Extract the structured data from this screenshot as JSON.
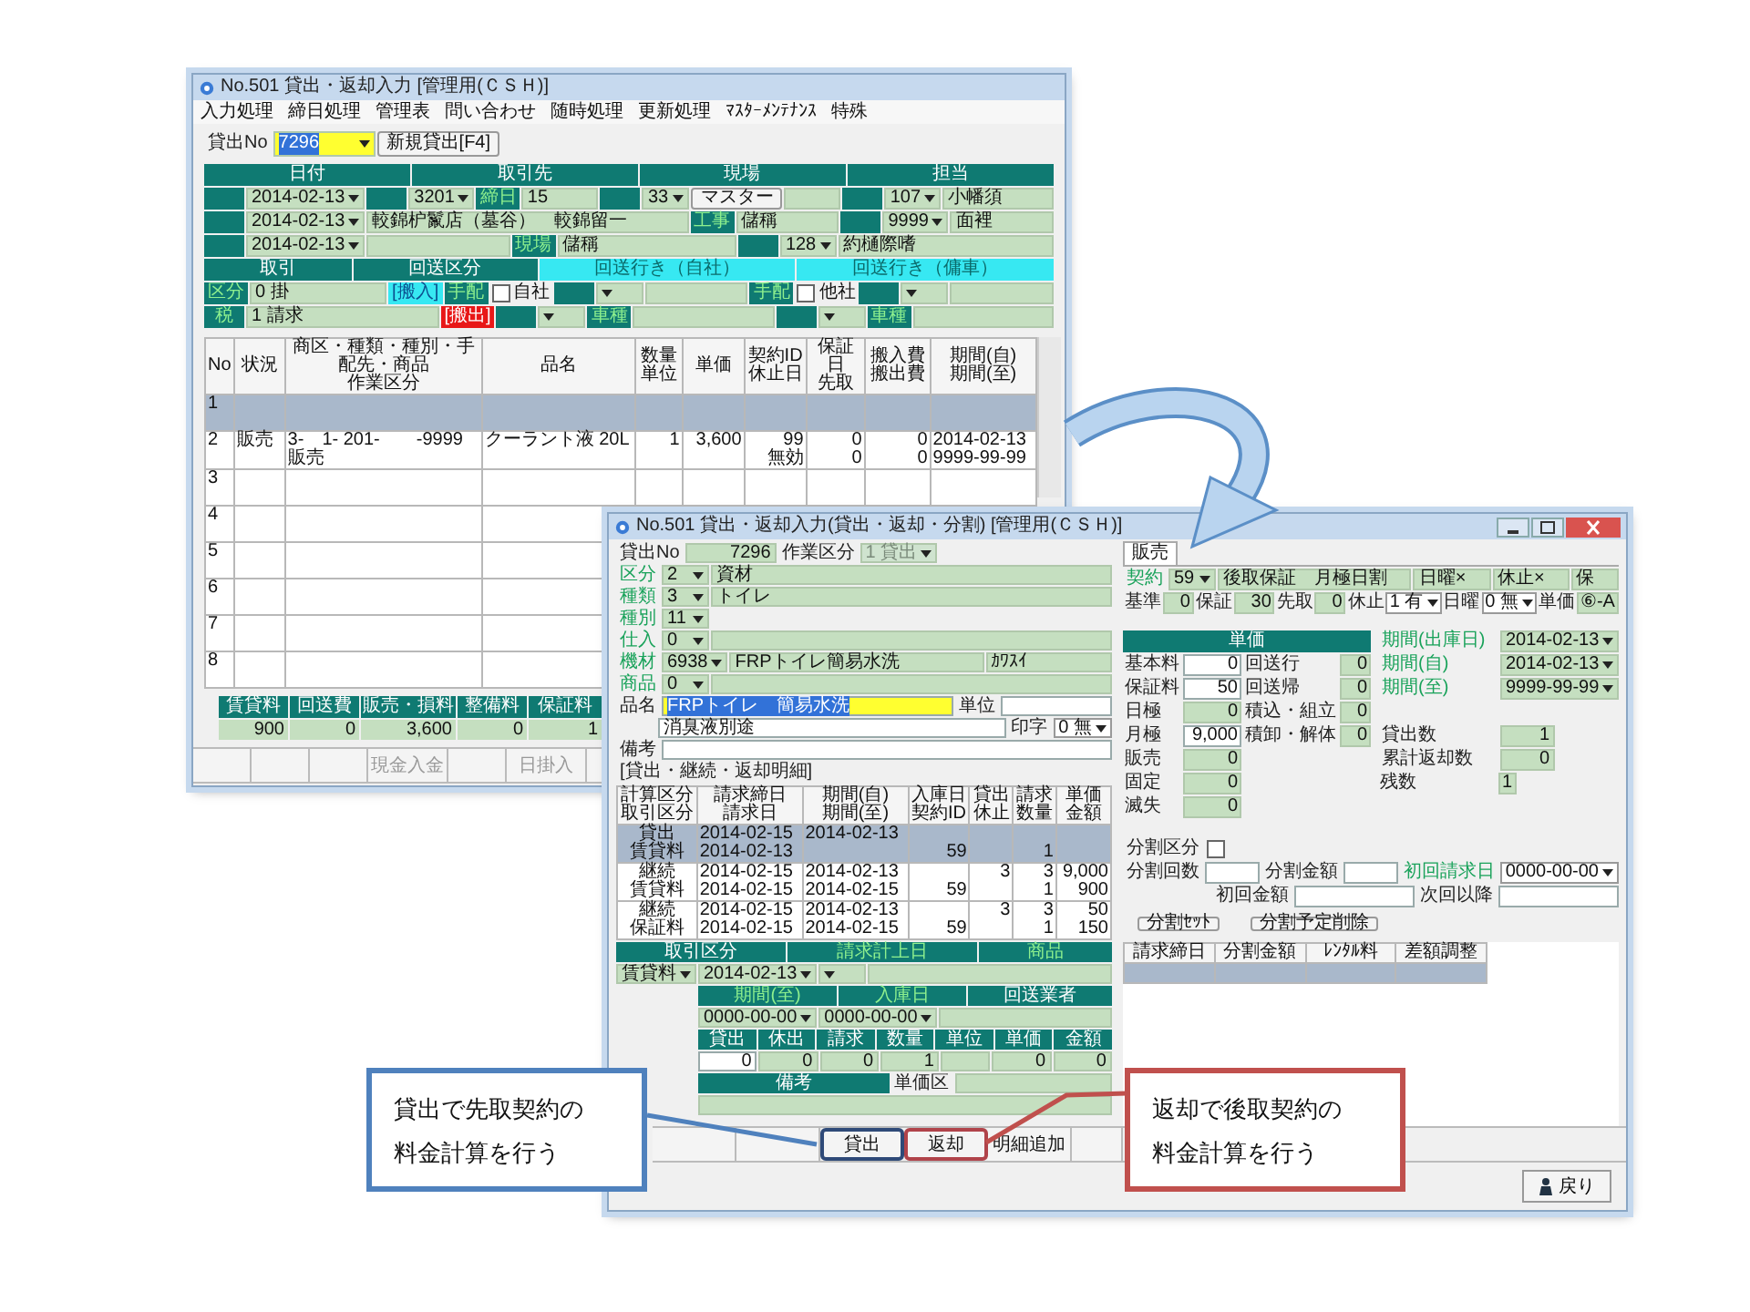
{
  "back_window": {
    "title": "No.501 貸出・返却入力 [管理用(ＣＳＨ)]",
    "menu": [
      "入力処理",
      "締日処理",
      "管理表",
      "問い合わせ",
      "随時処理",
      "更新処理",
      "ﾏｽﾀｰﾒﾝﾃﾅﾝｽ",
      "特殊"
    ],
    "form_rows": [
      [
        {
          "kind": "plain",
          "text": "貸出No"
        },
        {
          "kind": "hselect",
          "text": "7296"
        },
        {
          "kind": "button",
          "text": "新規貸出[F4]"
        }
      ],
      [
        {
          "kind": "head",
          "text": "日付"
        },
        {
          "kind": "head",
          "text": "取引先"
        },
        {
          "kind": "head",
          "text": "現場"
        },
        {
          "kind": "head",
          "text": "担当"
        }
      ],
      [
        {
          "kind": "tag"
        },
        {
          "kind": "select",
          "text": "2014-02-13"
        },
        {
          "kind": "tag"
        },
        {
          "kind": "select",
          "text": "3201"
        },
        {
          "kind": "tag",
          "text": "締日"
        },
        {
          "kind": "field",
          "text": "15"
        },
        {
          "kind": "tag"
        },
        {
          "kind": "select",
          "text": "33"
        },
        {
          "kind": "button",
          "text": "マスター"
        },
        {
          "kind": "field"
        },
        {
          "kind": "tag"
        },
        {
          "kind": "select",
          "text": "107"
        },
        {
          "kind": "field",
          "text": "小幡須"
        }
      ],
      [
        {
          "kind": "tag"
        },
        {
          "kind": "select",
          "text": "2014-02-13"
        },
        {
          "kind": "field",
          "text": "較錦枦鬣店（墓谷）　較錦留一"
        },
        {
          "kind": "tag",
          "text": "工事"
        },
        {
          "kind": "field",
          "text": "儲稱"
        },
        {
          "kind": "tag"
        },
        {
          "kind": "select",
          "text": "9999"
        },
        {
          "kind": "field",
          "text": "面裡"
        }
      ],
      [
        {
          "kind": "tag"
        },
        {
          "kind": "select",
          "text": "2014-02-13"
        },
        {
          "kind": "field"
        },
        {
          "kind": "tag",
          "text": "現場"
        },
        {
          "kind": "field",
          "text": "儲稱"
        },
        {
          "kind": "tag"
        },
        {
          "kind": "select",
          "text": "128"
        },
        {
          "kind": "field",
          "text": "約樋際嗜"
        }
      ],
      [
        {
          "kind": "head",
          "text": "取引"
        },
        {
          "kind": "head",
          "text": "回送区分"
        },
        {
          "kind": "cyan",
          "text": "回送行き（自社）"
        },
        {
          "kind": "cyan",
          "text": "回送行き（傭車）"
        }
      ],
      [
        {
          "kind": "tag",
          "text": "区分"
        },
        {
          "kind": "field",
          "text": "0 掛"
        },
        {
          "kind": "cyantag",
          "text": "[搬入]"
        },
        {
          "kind": "tag",
          "text": "手配"
        },
        {
          "kind": "check",
          "text": "自社",
          "checked": false
        },
        {
          "kind": "tag"
        },
        {
          "kind": "select"
        },
        {
          "kind": "field"
        },
        {
          "kind": "tag",
          "text": "手配"
        },
        {
          "kind": "check",
          "text": "他社",
          "checked": false
        },
        {
          "kind": "tag"
        },
        {
          "kind": "select"
        },
        {
          "kind": "field"
        }
      ],
      [
        {
          "kind": "tag",
          "text": "税"
        },
        {
          "kind": "field",
          "text": "1 請求"
        },
        {
          "kind": "red",
          "text": "[搬出]"
        },
        {
          "kind": "tag"
        },
        {
          "kind": "select"
        },
        {
          "kind": "tag",
          "text": "車種"
        },
        {
          "kind": "field"
        },
        {
          "kind": "tag"
        },
        {
          "kind": "select"
        },
        {
          "kind": "tag",
          "text": "車種"
        },
        {
          "kind": "field"
        }
      ]
    ],
    "table": {
      "columns": [
        "No",
        "状況",
        [
          "商区・種類・種別・手配先・商品",
          "作業区分"
        ],
        "品名",
        [
          "数量",
          "単位"
        ],
        "単価",
        [
          "契約ID",
          "休止日"
        ],
        [
          "保証日",
          "先取"
        ],
        [
          "搬入費",
          "搬出費"
        ],
        [
          "期間(自)",
          "期間(至)"
        ]
      ],
      "rows": [
        {
          "selected": true,
          "cells": [
            "1"
          ]
        },
        {
          "selected": false,
          "cells": [
            "2",
            "販売",
            [
              "3-　1- 201-　　-9999",
              "販売"
            ],
            "クーラント液 20L",
            "1",
            "3,600",
            [
              "99",
              "無効"
            ],
            [
              "0",
              "0"
            ],
            [
              "0",
              "0"
            ],
            [
              "2014-02-13",
              "9999-99-99"
            ]
          ]
        },
        {
          "selected": false,
          "cells": [
            "3"
          ]
        },
        {
          "selected": false,
          "cells": [
            "4"
          ]
        },
        {
          "selected": false,
          "cells": [
            "5"
          ]
        },
        {
          "selected": false,
          "cells": [
            "6"
          ]
        },
        {
          "selected": false,
          "cells": [
            "7"
          ]
        },
        {
          "selected": false,
          "cells": [
            "8"
          ]
        }
      ]
    },
    "totals": {
      "columns": [
        "賃貸料",
        "回送費",
        "販売・損料",
        "整備料",
        "保証料"
      ],
      "values": [
        "900",
        "0",
        "3,600",
        "0",
        "1"
      ]
    },
    "buttons": [
      {
        "kind": "blank"
      },
      {
        "kind": "blank"
      },
      {
        "kind": "blank"
      },
      {
        "kind": "action",
        "label": "現金入金",
        "disabled": true
      },
      {
        "kind": "blank"
      },
      {
        "kind": "action",
        "label": "日掛入",
        "disabled": true
      },
      {
        "kind": "blank"
      }
    ]
  },
  "front_window": {
    "title": "No.501 貸出・返却入力(貸出・返却・分割) [管理用(ＣＳＨ)]",
    "form_rows": [
      [
        {
          "kind": "plain",
          "text": "貸出No"
        },
        {
          "kind": "nfield",
          "text": "7296"
        },
        {
          "kind": "plain",
          "text": "作業区分"
        },
        {
          "kind": "dselect",
          "text": "1 貸出"
        }
      ],
      [
        {
          "kind": "glabel",
          "text": "区分"
        },
        {
          "kind": "select",
          "text": "2"
        },
        {
          "kind": "field",
          "text": "資材"
        }
      ],
      [
        {
          "kind": "glabel",
          "text": "種類"
        },
        {
          "kind": "select",
          "text": "3"
        },
        {
          "kind": "field",
          "text": "トイレ"
        }
      ],
      [
        {
          "kind": "glabel",
          "text": "種別"
        },
        {
          "kind": "select",
          "text": "11"
        }
      ],
      [
        {
          "kind": "glabel",
          "text": "仕入"
        },
        {
          "kind": "select",
          "text": "0"
        },
        {
          "kind": "field"
        }
      ],
      [
        {
          "kind": "glabel",
          "text": "機材"
        },
        {
          "kind": "select",
          "text": "6938"
        },
        {
          "kind": "field",
          "text": "FRPトイレ簡易水洗"
        },
        {
          "kind": "field",
          "text": "ｶﾜｽｲ"
        }
      ],
      [
        {
          "kind": "glabel",
          "text": "商品"
        },
        {
          "kind": "select",
          "text": "0"
        },
        {
          "kind": "field"
        }
      ],
      [
        {
          "kind": "plain",
          "text": "品名"
        },
        {
          "kind": "hinput",
          "text": "FRPトイレ　簡易水洗"
        },
        {
          "kind": "plain",
          "text": "単位"
        },
        {
          "kind": "input"
        }
      ],
      [
        {
          "kind": "spacer"
        },
        {
          "kind": "input",
          "text": "消臭液別途"
        },
        {
          "kind": "plain",
          "text": "印字"
        },
        {
          "kind": "wselect",
          "text": "0 無"
        }
      ],
      [
        {
          "kind": "plain",
          "text": "備考"
        },
        {
          "kind": "input"
        }
      ],
      [
        {
          "kind": "plain",
          "text": "[貸出・継続・返却明細]"
        }
      ]
    ],
    "table": {
      "header_rows": [
        [
          "計算区分",
          "請求締日",
          "期間(自)",
          "入庫日",
          "貸出",
          "請求",
          "単価"
        ],
        [
          "取引区分",
          "請求日",
          "期間(至)",
          "契約ID",
          "休止",
          "数量",
          "金額"
        ]
      ],
      "rows": [
        {
          "selected": true,
          "cells": [
            [
              "貸出",
              "賃貸料"
            ],
            [
              "2014-02-15",
              "2014-02-13"
            ],
            "2014-02-13",
            [
              null,
              "59"
            ],
            null,
            [
              null,
              "1"
            ]
          ]
        },
        {
          "selected": false,
          "cells": [
            [
              "継続",
              "賃貸料"
            ],
            [
              "2014-02-15",
              "2014-02-15"
            ],
            [
              "2014-02-13",
              "2014-02-15"
            ],
            [
              null,
              "59"
            ],
            "3",
            [
              "3",
              "1"
            ],
            [
              "9,000",
              "900"
            ]
          ]
        },
        {
          "selected": false,
          "cells": [
            [
              "継続",
              "保証料"
            ],
            [
              "2014-02-15",
              "2014-02-15"
            ],
            [
              "2014-02-13",
              "2014-02-15"
            ],
            [
              null,
              "59"
            ],
            "3",
            [
              "3",
              "1"
            ],
            [
              "50",
              "150"
            ]
          ]
        }
      ]
    },
    "bottom_rows": [
      [
        {
          "kind": "head",
          "text": "取引区分"
        },
        {
          "kind": "ghead",
          "text": "請求計上日"
        },
        {
          "kind": "ghead",
          "text": "商品"
        }
      ],
      [
        {
          "kind": "select",
          "text": "賃貸料"
        },
        {
          "kind": "select",
          "text": "2014-02-13"
        },
        {
          "kind": "select"
        },
        {
          "kind": "field"
        }
      ],
      [
        {
          "kind": "spacer"
        },
        {
          "kind": "ghead",
          "text": "期間(至)"
        },
        {
          "kind": "ghead",
          "text": "入庫日"
        },
        {
          "kind": "head",
          "text": "回送業者"
        }
      ],
      [
        {
          "kind": "spacer"
        },
        {
          "kind": "select",
          "text": "0000-00-00"
        },
        {
          "kind": "select",
          "text": "0000-00-00"
        },
        {
          "kind": "field"
        }
      ],
      [
        {
          "kind": "spacer"
        },
        {
          "kind": "head",
          "text": "貸出"
        },
        {
          "kind": "head",
          "text": "休出"
        },
        {
          "kind": "head",
          "text": "請求"
        },
        {
          "kind": "head",
          "text": "数量"
        },
        {
          "kind": "head",
          "text": "単位"
        },
        {
          "kind": "head",
          "text": "単価"
        },
        {
          "kind": "head",
          "text": "金額"
        }
      ],
      [
        {
          "kind": "spacer"
        },
        {
          "kind": "ninput",
          "text": "0"
        },
        {
          "kind": "nfield",
          "text": "0"
        },
        {
          "kind": "nfield",
          "text": "0"
        },
        {
          "kind": "nfield",
          "text": "1"
        },
        {
          "kind": "field"
        },
        {
          "kind": "nfield",
          "text": "0"
        },
        {
          "kind": "nfield",
          "text": "0"
        }
      ],
      [
        {
          "kind": "spacer"
        },
        {
          "kind": "head",
          "text": "備考"
        },
        {
          "kind": "plain",
          "text": "単価区"
        },
        {
          "kind": "field"
        }
      ],
      [
        {
          "kind": "spacer"
        },
        {
          "kind": "field"
        }
      ]
    ],
    "tabs": [
      {
        "label": "販売",
        "selected": true
      }
    ],
    "contract_rows": [
      [
        {
          "kind": "glabel",
          "text": "契約"
        },
        {
          "kind": "select",
          "text": "59"
        },
        {
          "kind": "field",
          "text": "後取保証　月極日割"
        },
        {
          "kind": "field",
          "text": "日曜×"
        },
        {
          "kind": "field",
          "text": "休止×"
        },
        {
          "kind": "field",
          "text": "保"
        }
      ],
      [
        {
          "kind": "plain",
          "text": "基準"
        },
        {
          "kind": "nfield",
          "text": "0"
        },
        {
          "kind": "plain",
          "text": "保証"
        },
        {
          "kind": "nfield",
          "text": "30"
        },
        {
          "kind": "plain",
          "text": "先取"
        },
        {
          "kind": "nfield",
          "text": "0"
        },
        {
          "kind": "plain",
          "text": "休止"
        },
        {
          "kind": "wselect",
          "text": "1 有"
        },
        {
          "kind": "plain",
          "text": "日曜"
        },
        {
          "kind": "wselect",
          "text": "0 無"
        },
        {
          "kind": "plain",
          "text": "単価"
        },
        {
          "kind": "field",
          "text": "⑥-A"
        }
      ]
    ],
    "price_header": "単価",
    "price_rows": [
      [
        {
          "kind": "plain",
          "text": "基本料"
        },
        {
          "kind": "ninput",
          "text": "0"
        },
        {
          "kind": "plain",
          "text": "回送行"
        },
        {
          "kind": "nfield",
          "text": "0"
        }
      ],
      [
        {
          "kind": "plain",
          "text": "保証料"
        },
        {
          "kind": "ninput",
          "text": "50"
        },
        {
          "kind": "plain",
          "text": "回送帰"
        },
        {
          "kind": "nfield",
          "text": "0"
        }
      ],
      [
        {
          "kind": "plain",
          "text": "日極"
        },
        {
          "kind": "nfield",
          "text": "0"
        },
        {
          "kind": "plain",
          "text": "積込・組立"
        },
        {
          "kind": "nfield",
          "text": "0"
        }
      ],
      [
        {
          "kind": "plain",
          "text": "月極"
        },
        {
          "kind": "ninput",
          "text": "9,000"
        },
        {
          "kind": "plain",
          "text": "積卸・解体"
        },
        {
          "kind": "nfield",
          "text": "0"
        }
      ],
      [
        {
          "kind": "plain",
          "text": "販売"
        },
        {
          "kind": "nfield",
          "text": "0"
        }
      ],
      [
        {
          "kind": "plain",
          "text": "固定"
        },
        {
          "kind": "nfield",
          "text": "0"
        }
      ],
      [
        {
          "kind": "plain",
          "text": "滅失"
        },
        {
          "kind": "nfield",
          "text": "0"
        }
      ]
    ],
    "period_rows": [
      [
        {
          "kind": "glabel",
          "text": "期間(出庫日)"
        },
        {
          "kind": "select",
          "text": "2014-02-13"
        }
      ],
      [
        {
          "kind": "glabel",
          "text": "期間(自)"
        },
        {
          "kind": "select",
          "text": "2014-02-13"
        }
      ],
      [
        {
          "kind": "glabel",
          "text": "期間(至)"
        },
        {
          "kind": "select",
          "text": "9999-99-99"
        }
      ],
      [
        {
          "kind": "plain",
          "text": "貸出数"
        },
        {
          "kind": "nfield",
          "text": "1"
        }
      ],
      [
        {
          "kind": "plain",
          "text": "累計返却数"
        },
        {
          "kind": "nfield",
          "text": "0"
        }
      ],
      [
        {
          "kind": "plain",
          "text": "残数"
        },
        {
          "kind": "nfield",
          "text": "1"
        }
      ]
    ],
    "split_rows": [
      [
        {
          "kind": "plain",
          "text": "分割区分"
        },
        {
          "kind": "check",
          "checked": false
        }
      ],
      [
        {
          "kind": "plain",
          "text": "分割回数"
        },
        {
          "kind": "input"
        },
        {
          "kind": "plain",
          "text": "分割金額"
        },
        {
          "kind": "input"
        },
        {
          "kind": "glabel",
          "text": "初回請求日"
        },
        {
          "kind": "wselect",
          "text": "0000-00-00"
        }
      ],
      [
        {
          "kind": "spacer"
        },
        {
          "kind": "plain",
          "text": "初回金額"
        },
        {
          "kind": "input"
        },
        {
          "kind": "plain",
          "text": "次回以降"
        },
        {
          "kind": "input"
        }
      ],
      [
        {
          "kind": "button",
          "text": "分割ｾｯﾄ"
        },
        {
          "kind": "button",
          "text": "分割予定削除"
        }
      ]
    ],
    "split_table": {
      "columns": [
        "請求締日",
        "分割金額",
        "ﾚﾝﾀﾙ料",
        "差額調整"
      ],
      "rows": [
        {
          "selected": true
        }
      ]
    },
    "buttons": [
      {
        "kind": "blank"
      },
      {
        "kind": "blank"
      },
      {
        "kind": "action",
        "label": "貸出",
        "color": "#2f4a78"
      },
      {
        "kind": "action",
        "label": "返却",
        "color": "#b0434a"
      },
      {
        "kind": "action",
        "label": "明細追加"
      },
      {
        "kind": "blank"
      }
    ],
    "back_button": "戻り"
  },
  "callouts": [
    {
      "lines": [
        "貸出で先取契約の",
        "料金計算を行う"
      ],
      "color": "#4f81bd"
    },
    {
      "lines": [
        "返却で後取契約の",
        "料金計算を行う"
      ],
      "color": "#c0504d"
    }
  ]
}
